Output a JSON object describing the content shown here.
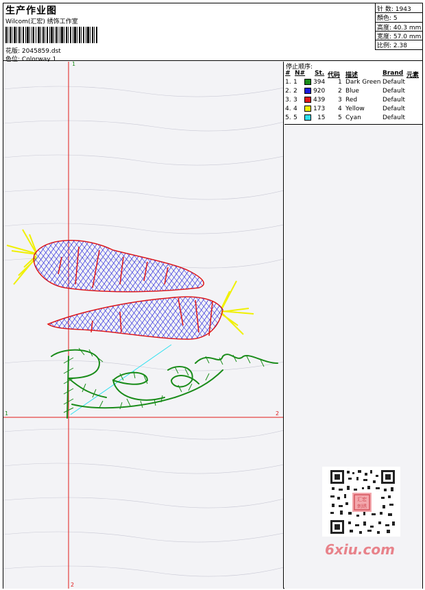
{
  "header": {
    "title": "生产作业图",
    "company": "Wilcom(汇宏) 绣饰工作室",
    "design_label": "花版:",
    "design_file": "2045859.dst",
    "color_label": "色位:",
    "colorway": "Colorway 1"
  },
  "stats": [
    {
      "label": "针 数:",
      "value": "1943"
    },
    {
      "label": "顏色:",
      "value": "5"
    },
    {
      "label": "高度:",
      "value": "40.3 mm"
    },
    {
      "label": "宽度:",
      "value": "57.0 mm"
    },
    {
      "label": "比例:",
      "value": "2.38"
    }
  ],
  "axes": {
    "top": "1",
    "left": "1",
    "right": "2",
    "bottom": "2"
  },
  "panel": {
    "title": "停止顺序:",
    "columns": [
      "#",
      "N#",
      "St.",
      "代码",
      "描述",
      "Brand",
      "元素"
    ]
  },
  "stops": [
    {
      "num": "1.",
      "n": "1",
      "stitches": "394",
      "code": "1",
      "desc": "Dark Green",
      "brand": "Default",
      "color": "#1a8c1a"
    },
    {
      "num": "2.",
      "n": "2",
      "stitches": "920",
      "code": "2",
      "desc": "Blue",
      "brand": "Default",
      "color": "#1c1cdc"
    },
    {
      "num": "3.",
      "n": "3",
      "stitches": "439",
      "code": "3",
      "desc": "Red",
      "brand": "Default",
      "color": "#e01818"
    },
    {
      "num": "4.",
      "n": "4",
      "stitches": "173",
      "code": "4",
      "desc": "Yellow",
      "brand": "Default",
      "color": "#f0f000"
    },
    {
      "num": "5.",
      "n": "5",
      "stitches": "15",
      "code": "5",
      "desc": "Cyan",
      "brand": "Default",
      "color": "#30e0f0"
    }
  ],
  "watermark": {
    "site": "6xiu.com",
    "seal": "汇宏 刺绣"
  }
}
